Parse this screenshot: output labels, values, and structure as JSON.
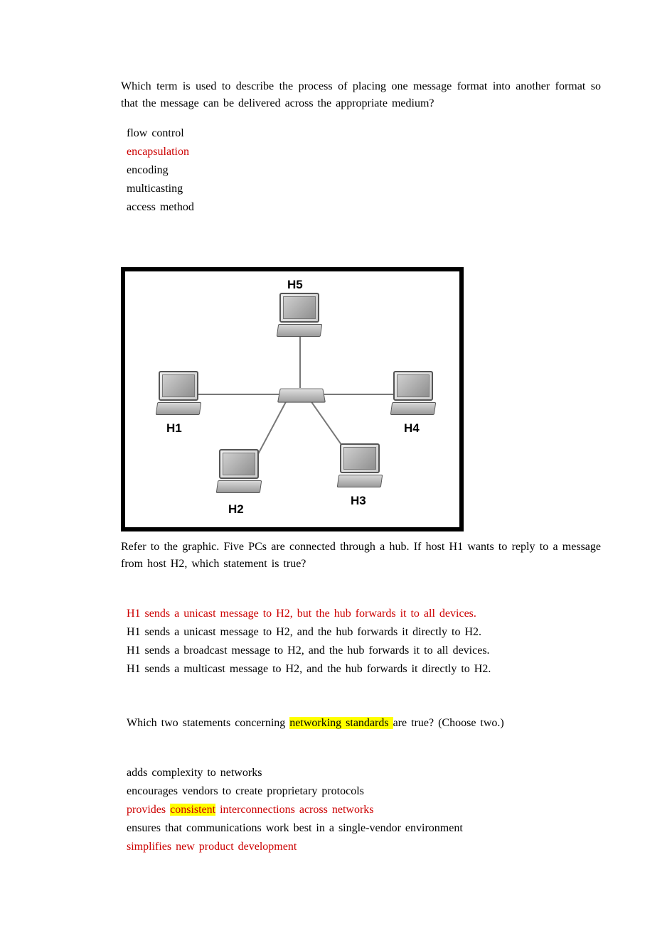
{
  "q1": {
    "prompt": "Which term is used to describe the process of placing one message format into another format so that the message can be delivered across the appropriate medium?",
    "options": [
      {
        "text": "flow control",
        "correct": false
      },
      {
        "text": "encapsulation",
        "correct": true
      },
      {
        "text": "encoding",
        "correct": false
      },
      {
        "text": "multicasting",
        "correct": false
      },
      {
        "text": "access method",
        "correct": false
      }
    ]
  },
  "diagram": {
    "nodes": [
      {
        "id": "H1",
        "label": "H1"
      },
      {
        "id": "H2",
        "label": "H2"
      },
      {
        "id": "H3",
        "label": "H3"
      },
      {
        "id": "H4",
        "label": "H4"
      },
      {
        "id": "H5",
        "label": "H5"
      }
    ],
    "center": "hub"
  },
  "q2": {
    "prompt": "Refer to the graphic. Five PCs are connected through a hub. If host H1 wants to reply to a message from host H2, which statement is true?",
    "options": [
      {
        "text": "H1 sends a unicast message to H2, but the hub forwards it to all devices.",
        "correct": true
      },
      {
        "text": "H1 sends a unicast message to H2, and the hub forwards it directly to H2.",
        "correct": false
      },
      {
        "text": "H1 sends a broadcast message to H2, and the hub forwards it to all devices.",
        "correct": false
      },
      {
        "text": "H1 sends a multicast message to H2, and the hub forwards it directly to H2.",
        "correct": false
      }
    ]
  },
  "q3": {
    "prompt_pre": "Which two statements concerning ",
    "prompt_hl": "networking standards ",
    "prompt_post": "are true? (Choose two.)",
    "options": [
      {
        "segments": [
          {
            "text": "adds complexity to networks"
          }
        ],
        "correct": false
      },
      {
        "segments": [
          {
            "text": "encourages vendors to create proprietary protocols"
          }
        ],
        "correct": false
      },
      {
        "segments": [
          {
            "text": "provides ",
            "hl": false
          },
          {
            "text": "consistent",
            "hl": true
          },
          {
            "text": " interconnections across networks",
            "hl": false
          }
        ],
        "correct": true
      },
      {
        "segments": [
          {
            "text": "ensures that communications work best in a single-vendor environment"
          }
        ],
        "correct": false
      },
      {
        "segments": [
          {
            "text": "simplifies new product development"
          }
        ],
        "correct": true
      }
    ]
  }
}
